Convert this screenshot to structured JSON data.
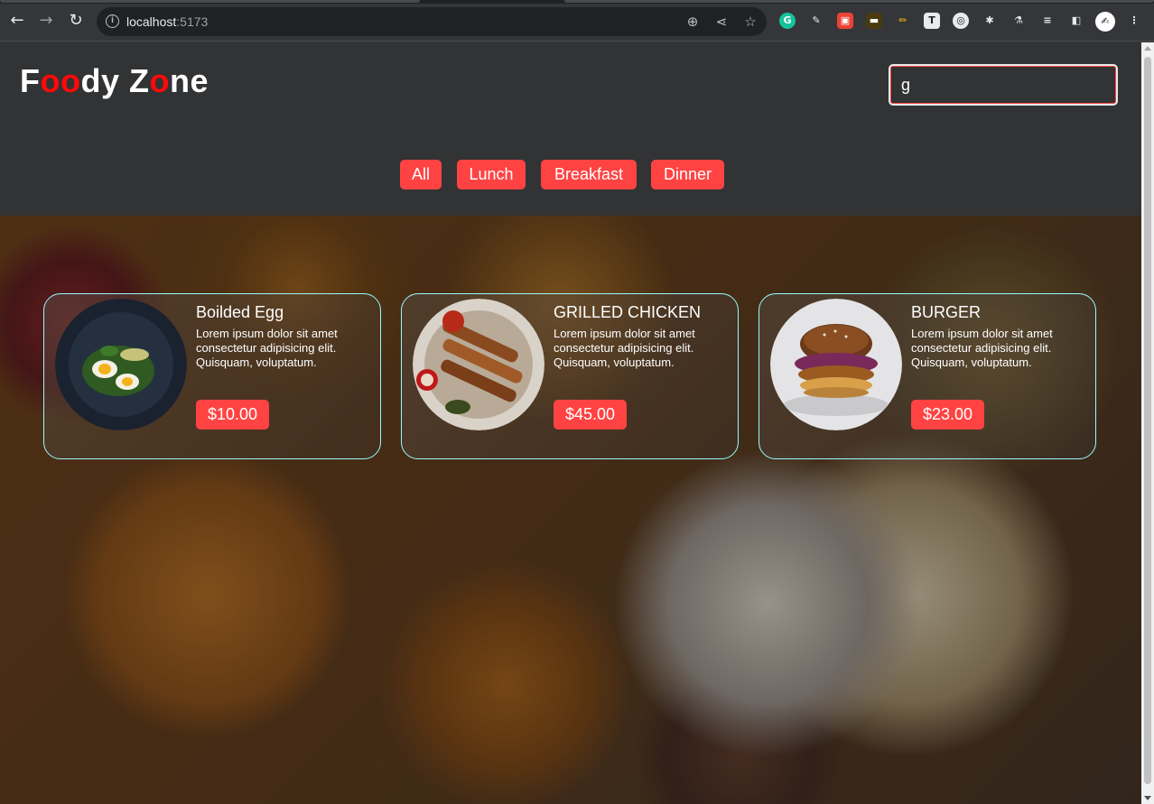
{
  "browser": {
    "url_host": "localhost",
    "url_port": ":5173"
  },
  "header": {
    "logo_parts": [
      "F",
      "oo",
      "dy Z",
      "o",
      "ne"
    ],
    "search_value": "g"
  },
  "filters": [
    "All",
    "Lunch",
    "Breakfast",
    "Dinner"
  ],
  "cards": [
    {
      "title": "Boilded Egg",
      "description": "Lorem ipsum dolor sit amet consectetur adipisicing elit. Quisquam, voluptatum.",
      "price": "$10.00"
    },
    {
      "title": "GRILLED CHICKEN",
      "description": "Lorem ipsum dolor sit amet consectetur adipisicing elit. Quisquam, voluptatum.",
      "price": "$45.00"
    },
    {
      "title": "BURGER",
      "description": "Lorem ipsum dolor sit amet consectetur adipisicing elit. Quisquam, voluptatum.",
      "price": "$23.00"
    }
  ],
  "colors": {
    "accent": "#ff4343",
    "logo_red": "#ff0909",
    "card_border": "#98f9ff",
    "header_bg": "#323334"
  }
}
